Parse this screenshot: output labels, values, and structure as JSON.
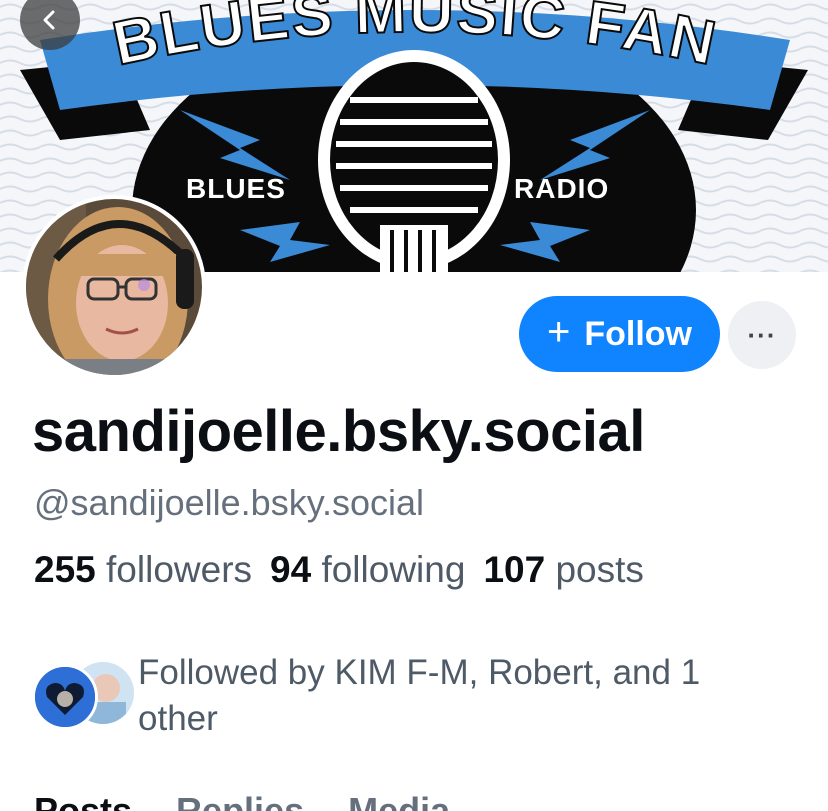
{
  "banner": {
    "title": "BLUES MUSIC FAN",
    "left_label": "BLUES",
    "right_label": "RADIO"
  },
  "profile": {
    "display_name": "sandijoelle.bsky.social",
    "handle": "@sandijoelle.bsky.social"
  },
  "actions": {
    "follow_label": "Follow",
    "follow_icon": "+",
    "more_label": "···"
  },
  "stats": {
    "followers_count": "255",
    "followers_label": "followers",
    "following_count": "94",
    "following_label": "following",
    "posts_count": "107",
    "posts_label": "posts"
  },
  "followed_by": {
    "text": "Followed by KIM F-M, Robert, and 1 other"
  },
  "tabs": [
    {
      "label": "Posts"
    },
    {
      "label": "Replies"
    },
    {
      "label": "Media"
    }
  ],
  "colors": {
    "accent": "#1083fe",
    "banner_blue": "#3a8ad6",
    "text_primary": "#0b0f14",
    "text_secondary": "#4f5a67"
  },
  "icons": {
    "back": "chevron-left-icon",
    "more": "ellipsis-icon"
  }
}
